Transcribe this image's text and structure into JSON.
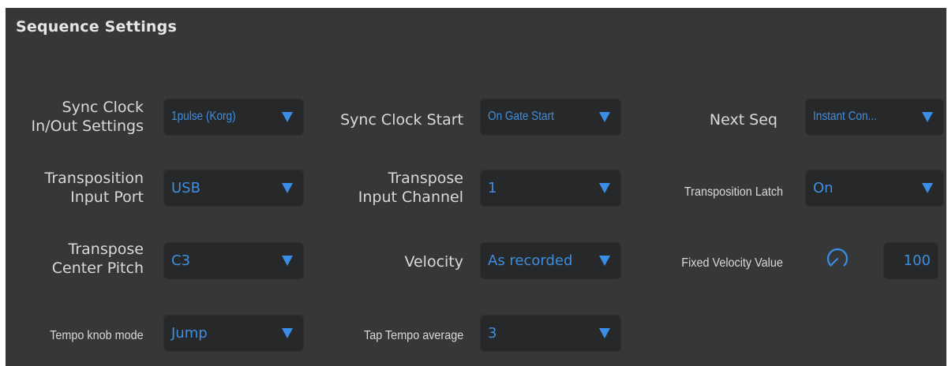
{
  "panel": {
    "title": "Sequence Settings"
  },
  "rows": {
    "sync_clock_settings": {
      "label_line1": "Sync Clock",
      "label_line2": "In/Out Settings",
      "value": "1pulse (Korg)"
    },
    "sync_clock_start": {
      "label": "Sync Clock Start",
      "value": "On Gate Start"
    },
    "next_seq": {
      "label": "Next Seq",
      "value": "Instant Con..."
    },
    "transposition_input_port": {
      "label_line1": "Transposition",
      "label_line2": "Input Port",
      "value": "USB"
    },
    "transpose_input_channel": {
      "label_line1": "Transpose",
      "label_line2": "Input Channel",
      "value": "1"
    },
    "transposition_latch": {
      "label": "Transposition Latch",
      "value": "On"
    },
    "transpose_center_pitch": {
      "label_line1": "Transpose",
      "label_line2": "Center Pitch",
      "value": "C3"
    },
    "velocity": {
      "label": "Velocity",
      "value": "As recorded"
    },
    "fixed_velocity_value": {
      "label": "Fixed Velocity Value",
      "value": "100",
      "knob_icon": "knob-icon"
    },
    "tempo_knob_mode": {
      "label": "Tempo knob mode",
      "value": "Jump"
    },
    "tap_tempo_average": {
      "label": "Tap Tempo average",
      "value": "3"
    }
  },
  "colors": {
    "panel_bg": "#363738",
    "control_bg": "#272829",
    "label_text": "#d9d9d9",
    "accent_blue": "#3f8ee0"
  }
}
